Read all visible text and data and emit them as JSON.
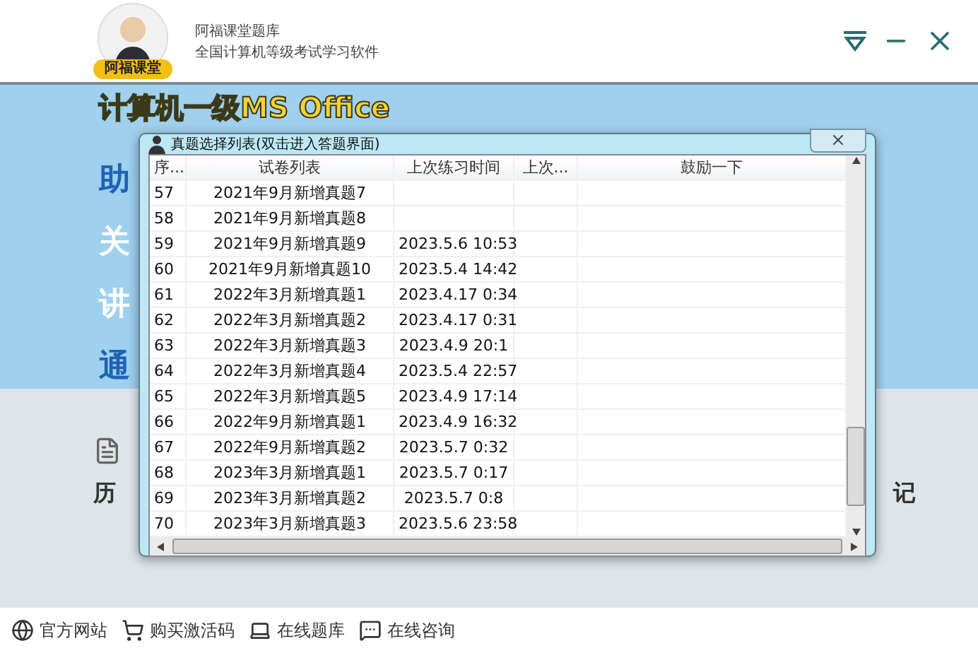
{
  "header": {
    "badge": "阿福课堂",
    "app_name": "阿福课堂题库",
    "subtitle": "全国计算机等级考试学习软件"
  },
  "banner": {
    "title": "计算机一级MS Office",
    "side_chars": [
      "助",
      "关",
      "讲",
      "通"
    ]
  },
  "panel": {
    "left_char": "历",
    "right_char": "记"
  },
  "dialog": {
    "title": "真题选择列表(双击进入答题界面)",
    "columns": [
      "序...",
      "试卷列表",
      "上次练习时间",
      "上次...",
      "鼓励一下"
    ],
    "rows": [
      {
        "no": "57",
        "paper": "2021年9月新增真题7"
      },
      {
        "no": "58",
        "paper": "2021年9月新增真题8"
      },
      {
        "no": "59",
        "paper": "2021年9月新增真题9",
        "time": "2023.5.6  10:53"
      },
      {
        "no": "60",
        "paper": "2021年9月新增真题10",
        "time": "2023.5.4  14:42"
      },
      {
        "no": "61",
        "paper": "2022年3月新增真题1",
        "time": "2023.4.17  0:34"
      },
      {
        "no": "62",
        "paper": "2022年3月新增真题2",
        "time": "2023.4.17  0:31"
      },
      {
        "no": "63",
        "paper": "2022年3月新增真题3",
        "time": "2023.4.9  20:1"
      },
      {
        "no": "64",
        "paper": "2022年3月新增真题4",
        "time": "2023.5.4  22:57"
      },
      {
        "no": "65",
        "paper": "2022年3月新增真题5",
        "time": "2023.4.9  17:14"
      },
      {
        "no": "66",
        "paper": "2022年9月新增真题1",
        "time": "2023.4.9  16:32"
      },
      {
        "no": "67",
        "paper": "2022年9月新增真题2",
        "time": "2023.5.7  0:32"
      },
      {
        "no": "68",
        "paper": "2023年3月新增真题1",
        "time": "2023.5.7  0:17"
      },
      {
        "no": "69",
        "paper": "2023年3月新增真题2",
        "time": "2023.5.7  0:8"
      },
      {
        "no": "70",
        "paper": "2023年3月新增真题3",
        "time": "2023.5.6  23:58"
      }
    ]
  },
  "footer": [
    {
      "kind": "globe",
      "label": "官方网站"
    },
    {
      "kind": "cart",
      "label": "购买激活码"
    },
    {
      "kind": "laptop",
      "label": "在线题库"
    },
    {
      "kind": "chat",
      "label": "在线咨询"
    }
  ]
}
